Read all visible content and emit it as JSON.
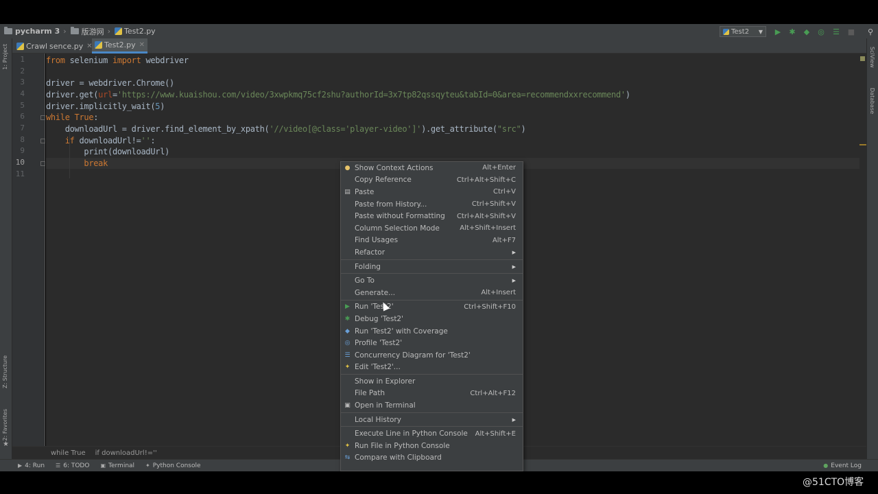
{
  "navbar": {
    "project": "pycharm",
    "project_num": "3",
    "folder": "版游网",
    "file": "Test2.py"
  },
  "run_config": {
    "label": "Test2"
  },
  "left_strip": {
    "project": "1: Project",
    "structure": "Z: Structure",
    "favorites": "2: Favorites"
  },
  "right_strip": {
    "sciview": "SciView",
    "database": "Database"
  },
  "tabs": [
    {
      "label": "Crawl",
      "active": false
    },
    {
      "label": "sence.py",
      "active": false
    },
    {
      "label": "Test2.py",
      "active": true
    }
  ],
  "editor": {
    "line_numbers": [
      "1",
      "2",
      "3",
      "4",
      "5",
      "6",
      "7",
      "8",
      "9",
      "10",
      "11"
    ],
    "lines": {
      "l1_from": "from",
      "l1_mod": " selenium ",
      "l1_import": "import",
      "l1_name": " webdriver",
      "l3": "driver = webdriver.Chrome()",
      "l4_a": "driver.get(",
      "l4_param": "url",
      "l4_eq": "=",
      "l4_str": "'https://www.kuaishou.com/video/3xwpkmq75cf2shu?authorId=3x7tp82qssqyteu&tabId=0&area=recommendxxrecommend'",
      "l4_end": ")",
      "l5_a": "driver.implicitly_wait(",
      "l5_num": "5",
      "l5_end": ")",
      "l6_while": "while",
      "l6_true": " True",
      "l6_colon": ":",
      "l7_a": "    downloadUrl = driver.find_element_by_xpath(",
      "l7_str": "'//video[@class='player-video']'",
      "l7_b": ").get_attribute(",
      "l7_str2": "\"src\"",
      "l7_end": ")",
      "l8_if": "    if",
      "l8_a": " downloadUrl!=",
      "l8_str": "''",
      "l8_colon": ":",
      "l9": "        print(downloadUrl)",
      "l10": "        break"
    }
  },
  "breadcrumb": {
    "a": "while True",
    "b": "if downloadUrl!=''"
  },
  "context_menu": {
    "items": [
      {
        "label": "Show Context Actions",
        "shortcut": "Alt+Enter",
        "icon": "bulb-icon"
      },
      {
        "label": "Copy Reference",
        "shortcut": "Ctrl+Alt+Shift+C"
      },
      {
        "label": "Paste",
        "shortcut": "Ctrl+V",
        "icon": "clipboard-icon"
      },
      {
        "label": "Paste from History...",
        "shortcut": "Ctrl+Shift+V"
      },
      {
        "label": "Paste without Formatting",
        "shortcut": "Ctrl+Alt+Shift+V"
      },
      {
        "label": "Column Selection Mode",
        "shortcut": "Alt+Shift+Insert"
      },
      {
        "label": "Find Usages",
        "shortcut": "Alt+F7"
      },
      {
        "label": "Refactor",
        "submenu": true
      },
      {
        "sep": true
      },
      {
        "label": "Folding",
        "submenu": true
      },
      {
        "sep": true
      },
      {
        "label": "Go To",
        "submenu": true
      },
      {
        "label": "Generate...",
        "shortcut": "Alt+Insert"
      },
      {
        "sep": true
      },
      {
        "label": "Run 'Test2'",
        "shortcut": "Ctrl+Shift+F10",
        "icon": "run-icon"
      },
      {
        "label": "Debug 'Test2'",
        "icon": "debug-icon"
      },
      {
        "label": "Run 'Test2' with Coverage",
        "icon": "coverage-icon"
      },
      {
        "label": "Profile 'Test2'",
        "icon": "profile-icon"
      },
      {
        "label": "Concurrency Diagram for 'Test2'",
        "icon": "concurrency-icon"
      },
      {
        "label": "Edit 'Test2'...",
        "icon": "python-icon"
      },
      {
        "sep": true
      },
      {
        "label": "Show in Explorer"
      },
      {
        "label": "File Path",
        "shortcut": "Ctrl+Alt+F12"
      },
      {
        "label": "Open in Terminal",
        "icon": "terminal-icon"
      },
      {
        "sep": true
      },
      {
        "label": "Local History",
        "submenu": true
      },
      {
        "sep": true
      },
      {
        "label": "Execute Line in Python Console",
        "shortcut": "Alt+Shift+E"
      },
      {
        "label": "Run File in Python Console",
        "icon": "python-icon"
      },
      {
        "label": "Compare with Clipboard",
        "icon": "compare-icon"
      }
    ]
  },
  "statusbar": {
    "run": "4: Run",
    "todo": "6: TODO",
    "terminal": "Terminal",
    "python_console": "Python Console",
    "event_log": "Event Log"
  },
  "watermark": "@51CTO博客",
  "colors": {
    "editor_bg": "#2b2b2b",
    "keyword": "#cc7832",
    "string": "#6a8759",
    "number": "#6897bb",
    "param": "#aa4926",
    "panel": "#3c3f41"
  }
}
